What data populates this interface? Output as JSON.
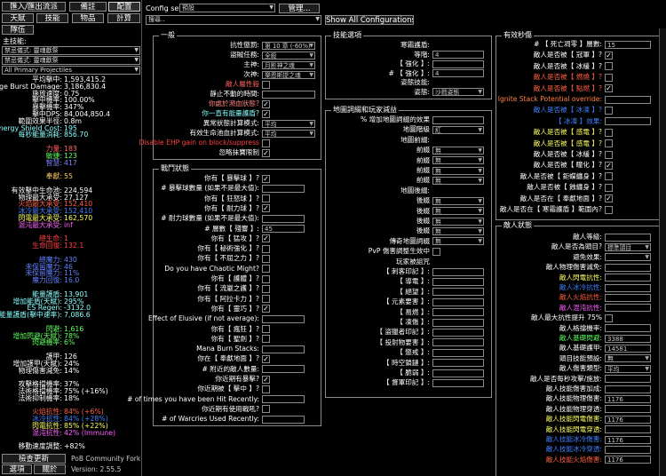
{
  "top_buttons": {
    "import_export": "匯入/匯出流派",
    "notes": "備註",
    "config": "配置"
  },
  "tabs": [
    "天賦",
    "技能",
    "物品",
    "計算"
  ],
  "party_btn": "隊伍",
  "main_skill_label": "主技能:",
  "skill_dd1": "禁忌儀式: 靈魂獻祭",
  "skill_dd2": "禁忌儀式: 靈魂獻祭",
  "skill_dd3": "All Primary Projectiles",
  "stats": [
    {
      "l": "平均擊中:",
      "v": "1,593,415.2",
      "c": "#ffffff"
    },
    {
      "l": "Average Burst Damage:",
      "v": "3,186,830.4",
      "c": "#ffffff"
    },
    {
      "l": "施放速度:",
      "v": "0.75",
      "c": "#ffffff"
    },
    {
      "l": "擊中機率:",
      "v": "100.00%",
      "c": "#ffffff"
    },
    {
      "l": "暴擊機率:",
      "v": "347%",
      "c": "#ffffff"
    },
    {
      "l": "擊中DPS:",
      "v": "84,004,850.4",
      "c": "#ffffff"
    },
    {
      "l": "範圍效果半徑:",
      "v": "0.8m",
      "c": "#ffffff"
    },
    {
      "l": "Energy Shield Cost:",
      "v": "195",
      "c": "#88ffff"
    },
    {
      "l": "每秒能量消耗:",
      "v": "856.70",
      "c": "#88ffff"
    },
    {
      "l": "",
      "v": "",
      "c": "#fff"
    },
    {
      "l": "力量:",
      "v": "183",
      "c": "#ff6060"
    },
    {
      "l": "敏捷:",
      "v": "123",
      "c": "#60ff60"
    },
    {
      "l": "智慧:",
      "v": "417",
      "c": "#8080ff"
    },
    {
      "l": "",
      "v": "",
      "c": "#fff"
    },
    {
      "l": "奉獻:",
      "v": "55",
      "c": "#ffcc66"
    },
    {
      "l": "",
      "v": "",
      "c": "#fff"
    },
    {
      "l": "有效擊中生命池:",
      "v": "224,594",
      "c": "#ffffff"
    },
    {
      "l": "物理最大承受:",
      "v": "27,127",
      "c": "#ffffff"
    },
    {
      "l": "火焰最大承受:",
      "v": "152,410",
      "c": "#ff6040"
    },
    {
      "l": "冰冷最大承受:",
      "v": "152,410",
      "c": "#4080ff"
    },
    {
      "l": "閃電最大承受:",
      "v": "162,570",
      "c": "#ffff60"
    },
    {
      "l": "混沌最大承受:",
      "v": "inf",
      "c": "#ff60ff"
    },
    {
      "l": "",
      "v": "",
      "c": "#fff"
    },
    {
      "l": "總生命:",
      "v": "1",
      "c": "#ff4040"
    },
    {
      "l": "生命回復:",
      "v": "132.1",
      "c": "#ff4040"
    },
    {
      "l": "",
      "v": "",
      "c": "#fff"
    },
    {
      "l": "總魔力:",
      "v": "430",
      "c": "#6080ff"
    },
    {
      "l": "未保留魔力:",
      "v": "46",
      "c": "#6080ff"
    },
    {
      "l": "未保留魔力:",
      "v": "11%",
      "c": "#6080ff"
    },
    {
      "l": "魔力回復:",
      "v": "16.0",
      "c": "#6080ff"
    },
    {
      "l": "",
      "v": "",
      "c": "#fff"
    },
    {
      "l": "能量護盾:",
      "v": "13,901",
      "c": "#88ffff"
    },
    {
      "l": "增加能盾(天賦):",
      "v": "295%",
      "c": "#88ffff"
    },
    {
      "l": "ES Regen:",
      "v": "-3132.0",
      "c": "#88ffff"
    },
    {
      "l": "能量護盾(擊中速率):",
      "v": "7,086.6",
      "c": "#88ffff"
    },
    {
      "l": "",
      "v": "",
      "c": "#fff"
    },
    {
      "l": "閃避:",
      "v": "1,616",
      "c": "#60ff60"
    },
    {
      "l": "增加閃避(天賦):",
      "v": "78%",
      "c": "#60ff60"
    },
    {
      "l": "閃避機率:",
      "v": "6%",
      "c": "#60ff60"
    },
    {
      "l": "",
      "v": "",
      "c": "#fff"
    },
    {
      "l": "護甲:",
      "v": "126",
      "c": "#ffffff"
    },
    {
      "l": "增加護甲(天賦):",
      "v": "24%",
      "c": "#ffffff"
    },
    {
      "l": "物理傷害減免:",
      "v": "14%",
      "c": "#ffffff"
    },
    {
      "l": "",
      "v": "",
      "c": "#fff"
    },
    {
      "l": "攻擊格擋機率:",
      "v": "37%",
      "c": "#ffffff"
    },
    {
      "l": "法術格擋機率:",
      "v": "75% (+16%)",
      "c": "#ffffff"
    },
    {
      "l": "法術抑制機率:",
      "v": "18%",
      "c": "#ffffff"
    },
    {
      "l": "",
      "v": "",
      "c": "#fff"
    },
    {
      "l": "火焰抗性:",
      "v": "84% (+6%)",
      "c": "#ff6040"
    },
    {
      "l": "冰冷抗性:",
      "v": "84% (+28%)",
      "c": "#4080ff"
    },
    {
      "l": "閃電抗性:",
      "v": "85% (+22%)",
      "c": "#ffff60"
    },
    {
      "l": "混沌抗性:",
      "v": "42% (Immune)",
      "c": "#ff60ff"
    },
    {
      "l": "",
      "v": "",
      "c": "#fff"
    },
    {
      "l": "移動速度調整:",
      "v": "+82%",
      "c": "#ffffff"
    }
  ],
  "bottom": {
    "check_update": "檢查更新",
    "fork": "PoB Community Fork",
    "options": "選項",
    "about": "關於",
    "version_label": "Version:",
    "version": "2.55.5"
  },
  "config_set_label": "Config set:",
  "config_set_value": "預設",
  "manage_btn": "管理...",
  "search_placeholder": "搜尋..",
  "show_all_btn": "Show All Configurations",
  "sections": {
    "general": "一般",
    "skill_options": "技能選項",
    "effective_dps": "有效秒傷",
    "combat": "戰鬥狀態",
    "map_mods": "地圖詞綴和玩家減益",
    "enemy_state": "敵人狀態"
  },
  "general_rows": [
    {
      "l": "抗性懲罰:",
      "ctl": "dd",
      "v": "第 10 章 (-60%)"
    },
    {
      "l": "盜賊任務:",
      "ctl": "dd",
      "v": "全殺"
    },
    {
      "l": "主神:",
      "ctl": "dd",
      "v": "月影神之魂"
    },
    {
      "l": "次神:",
      "ctl": "dd",
      "v": "樂恩斯提之魂"
    },
    {
      "l": "敵人屬性殺",
      "ctl": "chk",
      "v": "",
      "c": "#ff6060"
    },
    {
      "l": "靜止不動的時間:",
      "ctl": "num",
      "v": ""
    },
    {
      "l": "你處於瀕血狀態?",
      "ctl": "chk",
      "v": "✓",
      "c": "#ff8080"
    },
    {
      "l": "你一直有能量護盾?",
      "ctl": "chk",
      "v": "✓",
      "c": "#88ffff"
    },
    {
      "l": "異常狀態計算模式:",
      "ctl": "dd",
      "v": "平均"
    },
    {
      "l": "有效生命池血計算模式:",
      "ctl": "dd",
      "v": "平均"
    },
    {
      "l": "Disable EHP gain on block/suppress",
      "ctl": "chk",
      "v": "",
      "c": "#ff4040"
    },
    {
      "l": "忽略抹寶限制",
      "ctl": "chk",
      "v": "✓"
    }
  ],
  "skill_rows": [
    {
      "l": "寒霜護盾:",
      "ctl": "none",
      "v": ""
    },
    {
      "l": "等階:",
      "ctl": "num",
      "v": "4"
    },
    {
      "l": "【 強化 】:",
      "ctl": "num",
      "v": ""
    },
    {
      "l": "# 【 強化 】:",
      "ctl": "num",
      "v": "4"
    },
    {
      "l": "姿態技能:",
      "ctl": "none",
      "v": ""
    },
    {
      "l": "姿態:",
      "ctl": "dd",
      "v": "沙戮姿態"
    }
  ],
  "map_rows": [
    {
      "l": "% 增加地圖詞綴的效果",
      "ctl": "num",
      "v": ""
    },
    {
      "l": "地圖階級",
      "ctl": "dd",
      "v": "紅"
    },
    {
      "l": "地圖前綴:",
      "ctl": "none",
      "v": ""
    },
    {
      "l": "前綴",
      "ctl": "dd",
      "v": "無"
    },
    {
      "l": "前綴",
      "ctl": "dd",
      "v": "無"
    },
    {
      "l": "前綴",
      "ctl": "dd",
      "v": "無"
    },
    {
      "l": "前綴",
      "ctl": "dd",
      "v": "無"
    },
    {
      "l": "地圖後綴:",
      "ctl": "none",
      "v": ""
    },
    {
      "l": "後綴",
      "ctl": "dd",
      "v": "無"
    },
    {
      "l": "後綴",
      "ctl": "dd",
      "v": "無"
    },
    {
      "l": "後綴",
      "ctl": "dd",
      "v": "無"
    },
    {
      "l": "後綴",
      "ctl": "dd",
      "v": "無"
    },
    {
      "l": "傳奇地圖詞綴",
      "ctl": "dd",
      "v": "無"
    },
    {
      "l": "PvP 傷害調整生效中",
      "ctl": "chk",
      "v": ""
    },
    {
      "l": "玩家被詛咒",
      "ctl": "none",
      "v": ""
    },
    {
      "l": "【 刺客印記 】:",
      "ctl": "num",
      "v": ""
    },
    {
      "l": "【 導電 】:",
      "ctl": "num",
      "v": ""
    },
    {
      "l": "【 絕望 】:",
      "ctl": "num",
      "v": ""
    },
    {
      "l": "【 元素要害 】:",
      "ctl": "num",
      "v": ""
    },
    {
      "l": "【 易燃 】:",
      "ctl": "num",
      "v": ""
    },
    {
      "l": "【 凍傷 】:",
      "ctl": "num",
      "v": ""
    },
    {
      "l": "【 盜獵者印記 】:",
      "ctl": "num",
      "v": ""
    },
    {
      "l": "【 投射物要害 】:",
      "ctl": "num",
      "v": ""
    },
    {
      "l": "【 懲戒 】:",
      "ctl": "num",
      "v": ""
    },
    {
      "l": "【 時空鎖鏈 】:",
      "ctl": "num",
      "v": ""
    },
    {
      "l": "【 脆弱 】:",
      "ctl": "num",
      "v": ""
    },
    {
      "l": "【 督軍印記 】:",
      "ctl": "num",
      "v": ""
    }
  ],
  "effdps_rows": [
    {
      "l": "# 【 死亡凋零 】層數:",
      "ctl": "num",
      "v": "15",
      "c": "#fff"
    },
    {
      "l": "敵人是否被【 冠軍 】?",
      "ctl": "chk",
      "v": "✓",
      "c": "#fff"
    },
    {
      "l": "敵人是否被【 冰緩 】?",
      "ctl": "chk",
      "v": "",
      "c": "#fff"
    },
    {
      "l": "敵人是否被【 燃燒 】?",
      "ctl": "chk",
      "v": "",
      "c": "#ff6040"
    },
    {
      "l": "敵人是否被【 點燃 】?",
      "ctl": "chk",
      "v": "✓",
      "c": "#ff6040"
    },
    {
      "l": "Ignite Stack Potential override:",
      "ctl": "num",
      "v": "",
      "c": "#ff8040"
    },
    {
      "l": "敵人是否被【 冰凍 】?",
      "ctl": "chk",
      "v": "",
      "c": "#4080ff"
    },
    {
      "l": "【 冰凍 】效果:",
      "ctl": "num",
      "v": "",
      "c": "#4080ff"
    },
    {
      "l": "敵人是否被【 感電 】?",
      "ctl": "chk",
      "v": "",
      "c": "#ffff60"
    },
    {
      "l": "敵人是否被【 感電 】?",
      "ctl": "chk",
      "v": "",
      "c": "#ffff60"
    },
    {
      "l": "敵人是否被【 冰緩 】?",
      "ctl": "chk",
      "v": "",
      "c": "#fff"
    },
    {
      "l": "敵人是否被【 瞳化 】?",
      "ctl": "chk",
      "v": "✓",
      "c": "#fff"
    },
    {
      "l": "敵人是否被【 鉅蝶纏身 】?",
      "ctl": "chk",
      "v": "",
      "c": "#fff"
    },
    {
      "l": "敵人是否被【 蝕纏身 】?",
      "ctl": "chk",
      "v": "",
      "c": "#fff"
    },
    {
      "l": "敵人是否在【 奉獻地面 】?",
      "ctl": "chk",
      "v": "✓",
      "c": "#fff"
    },
    {
      "l": "敵人是否在【 寒霜護盾 】範圍內?",
      "ctl": "chk",
      "v": "",
      "c": "#fff"
    }
  ],
  "combat_rows": [
    {
      "l": "你有【 暴擊球 】?",
      "ctl": "chk",
      "v": "✓"
    },
    {
      "l": "# 暴擊球數量 (如果不是最大值):",
      "ctl": "num",
      "v": ""
    },
    {
      "l": "你有【 狂怒球 】?",
      "ctl": "chk",
      "v": ""
    },
    {
      "l": "你有【 耐力球 】?",
      "ctl": "chk",
      "v": "✓"
    },
    {
      "l": "# 耐力球數量 (如果不是最大值):",
      "ctl": "num",
      "v": ""
    },
    {
      "l": "# 層數【 殘響 】:",
      "ctl": "num",
      "v": "45"
    },
    {
      "l": "你有【 猛攻 】?",
      "ctl": "chk",
      "v": "✓"
    },
    {
      "l": "你有【 秘術強化 】?",
      "ctl": "chk",
      "v": ""
    },
    {
      "l": "你有【 不屈之力 】?",
      "ctl": "chk",
      "v": ""
    },
    {
      "l": "Do you have Chaotic Might?",
      "ctl": "chk",
      "v": ""
    },
    {
      "l": "你有【 護體 】?",
      "ctl": "chk",
      "v": ""
    },
    {
      "l": "你有【 流巖之護 】?",
      "ctl": "chk",
      "v": ""
    },
    {
      "l": "你有【 阿拉卡力 】?",
      "ctl": "chk",
      "v": ""
    },
    {
      "l": "你有【 靈巧 】?",
      "ctl": "chk",
      "v": "✓"
    },
    {
      "l": "Effect of Elusive (if not average):",
      "ctl": "num",
      "v": ""
    },
    {
      "l": "你有【 瘋狂 】?",
      "ctl": "chk",
      "v": ""
    },
    {
      "l": "你有【 聖劍 】?",
      "ctl": "chk",
      "v": ""
    },
    {
      "l": "Mana Burn Stacks:",
      "ctl": "num",
      "v": ""
    },
    {
      "l": "你在【 奉獻地面 】?",
      "ctl": "chk",
      "v": "✓"
    },
    {
      "l": "# 附近的敵人數量:",
      "ctl": "num",
      "v": ""
    },
    {
      "l": "你近期有暴擊?",
      "ctl": "chk",
      "v": "✓"
    },
    {
      "l": "你近期被【 擊中 】?",
      "ctl": "chk",
      "v": ""
    },
    {
      "l": "# of times you have been Hit Recently:",
      "ctl": "num",
      "v": ""
    },
    {
      "l": "你近期有使用戰吼?",
      "ctl": "chk",
      "v": ""
    },
    {
      "l": "# of Warcries Used Recently:",
      "ctl": "num",
      "v": ""
    }
  ],
  "enemy_rows": [
    {
      "l": "敵人等級:",
      "ctl": "num",
      "v": "",
      "c": "#fff"
    },
    {
      "l": "敵人是否為頭目?",
      "ctl": "dd",
      "v": "標準頭目",
      "c": "#fff"
    },
    {
      "l": "避免效果:",
      "ctl": "dd",
      "v": "",
      "c": "#fff"
    },
    {
      "l": "敵人物理傷害減免:",
      "ctl": "num",
      "v": "",
      "c": "#fff"
    },
    {
      "l": "敵人閃電抗性:",
      "ctl": "num",
      "v": "",
      "c": "#ffff60"
    },
    {
      "l": "敵人冰冷抗性:",
      "ctl": "num",
      "v": "",
      "c": "#4080ff"
    },
    {
      "l": "敵人火焰抗性:",
      "ctl": "num",
      "v": "",
      "c": "#ff6040"
    },
    {
      "l": "敵人混沌抗性:",
      "ctl": "num",
      "v": "",
      "c": "#ff60ff"
    },
    {
      "l": "敵人最大抗性提升 75%",
      "ctl": "chk",
      "v": "",
      "c": "#fff"
    },
    {
      "l": "敵人格擋機率:",
      "ctl": "num",
      "v": "",
      "c": "#fff"
    },
    {
      "l": "敵人基礎閃避:",
      "ctl": "num",
      "v": "3388",
      "c": "#60ff60"
    },
    {
      "l": "敵人基礎護甲:",
      "ctl": "num",
      "v": "14581",
      "c": "#fff"
    },
    {
      "l": "頭目技能預設:",
      "ctl": "dd",
      "v": "無",
      "c": "#fff"
    },
    {
      "l": "敵人傷害類型:",
      "ctl": "dd",
      "v": "平均",
      "c": "#fff"
    },
    {
      "l": "敵人是否每秒攻擊/施放:",
      "ctl": "num",
      "v": "",
      "c": "#fff"
    },
    {
      "l": "敵人技能傷害加成:",
      "ctl": "num",
      "v": "",
      "c": "#fff"
    },
    {
      "l": "敵人技能物理傷害:",
      "ctl": "num",
      "v": "1176",
      "c": "#fff"
    },
    {
      "l": "敵人技能物理穿透:",
      "ctl": "num",
      "v": "",
      "c": "#fff"
    },
    {
      "l": "敵人技能閃電傷害:",
      "ctl": "num",
      "v": "1176",
      "c": "#ffff60"
    },
    {
      "l": "敵人技能閃電穿透:",
      "ctl": "num",
      "v": "",
      "c": "#ffff60"
    },
    {
      "l": "敵人技能冰冷傷害:",
      "ctl": "num",
      "v": "1176",
      "c": "#4080ff"
    },
    {
      "l": "敵人技能冰冷穿透:",
      "ctl": "num",
      "v": "",
      "c": "#4080ff"
    },
    {
      "l": "敵人技能火焰傷害:",
      "ctl": "num",
      "v": "1176",
      "c": "#ff6040"
    }
  ]
}
